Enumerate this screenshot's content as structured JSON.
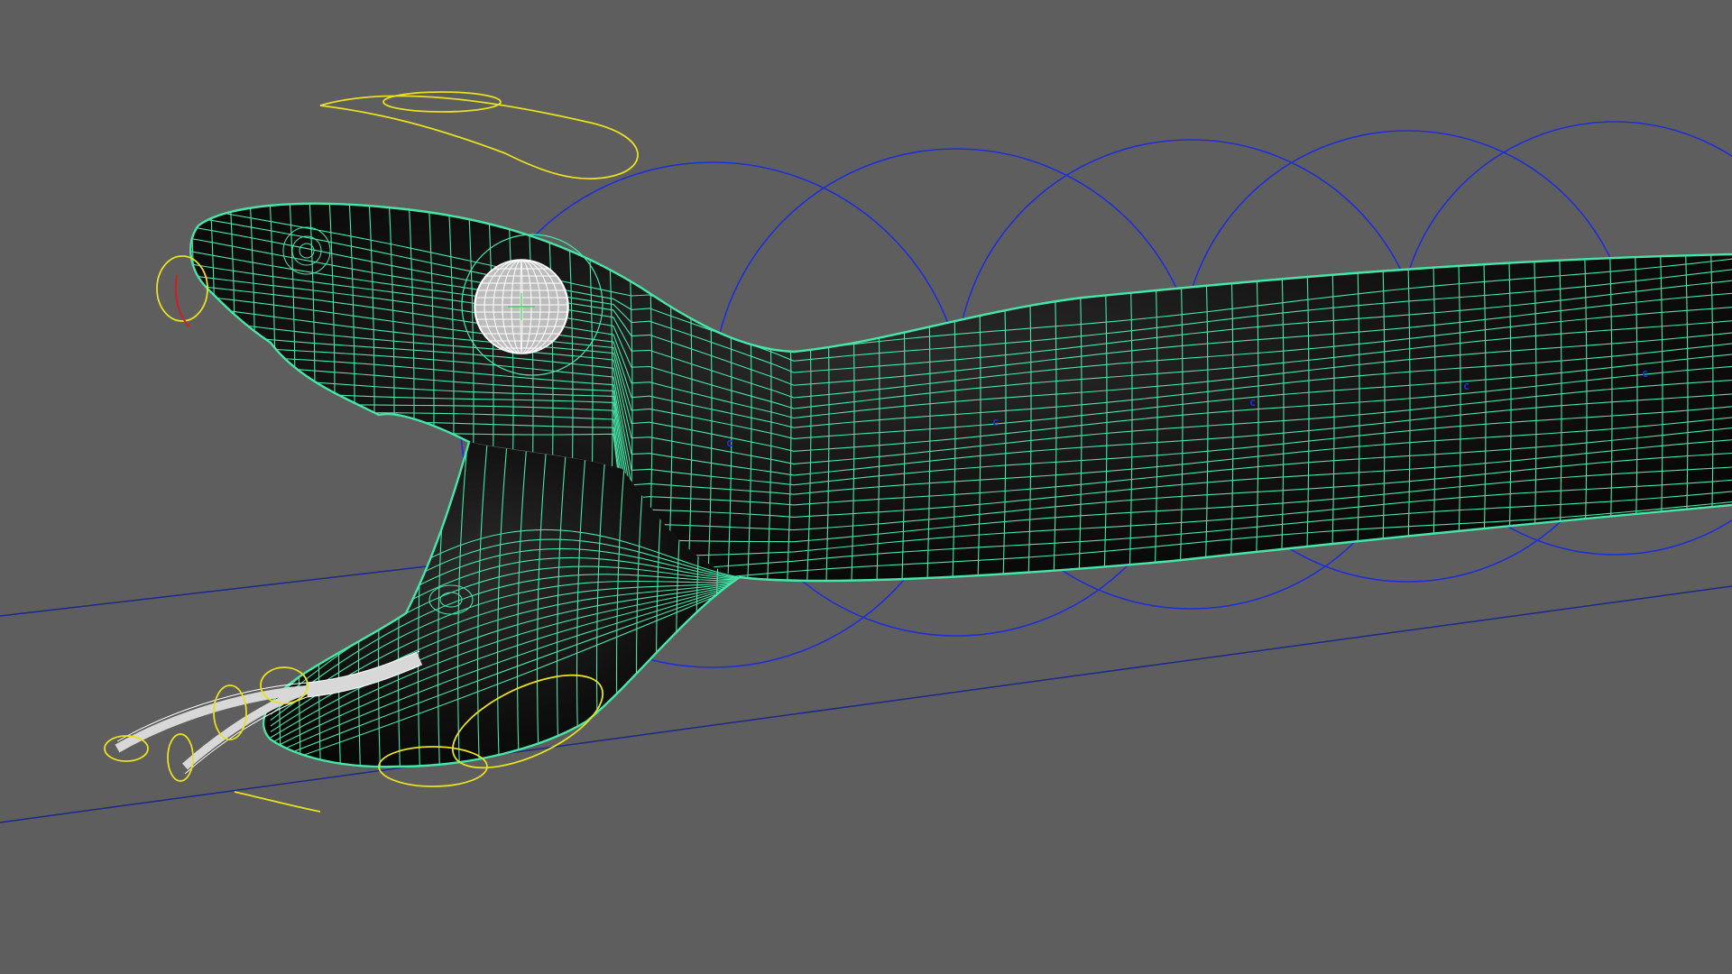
{
  "viewport": {
    "background": "#5e5e5e",
    "display_mode": "wireframe-on-shaded"
  },
  "colors": {
    "mesh_wire": "#46e6a8",
    "mesh_fill": "#0b0b0b",
    "spine_controls": "#1f2fd6",
    "ik_controls": "#e8e020",
    "eye_wire": "#ffffff",
    "tongue_wire": "#ffffff",
    "selection_highlight": "#d02020",
    "ground_line": "#1a2a8a"
  },
  "objects": [
    {
      "name": "snake-body-mesh",
      "icon": "polygon-mesh-icon"
    },
    {
      "name": "snake-eye-mesh",
      "icon": "sphere-icon"
    },
    {
      "name": "snake-tongue-mesh",
      "icon": "polygon-mesh-icon"
    },
    {
      "name": "spine-ring-controls",
      "count": 5,
      "icon": "circle-controller-icon"
    },
    {
      "name": "jaw-tongue-ik-controls",
      "icon": "curve-controller-icon"
    }
  ],
  "spine_cluster_labels": [
    "c",
    "c",
    "c",
    "c",
    "c"
  ]
}
